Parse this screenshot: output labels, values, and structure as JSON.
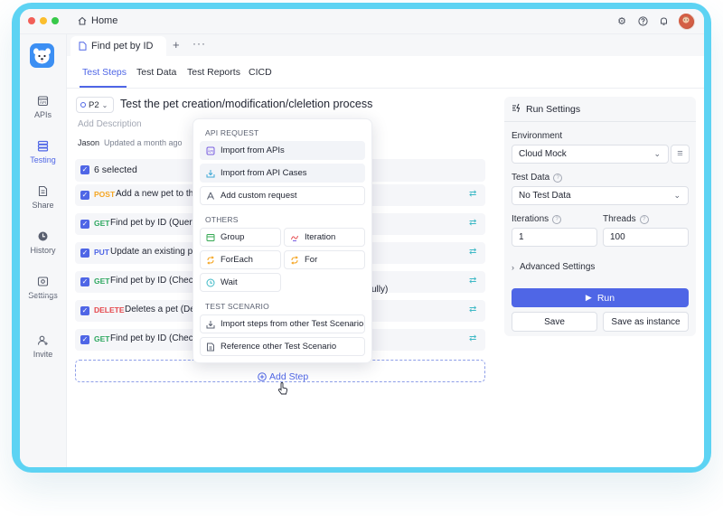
{
  "window": {
    "home_label": "Home",
    "colors": {
      "close": "#f25f58",
      "minimize": "#fbbe2e",
      "maximize": "#38c94a",
      "frame": "#5dd3f3",
      "accent": "#4f66e6"
    }
  },
  "sidebar": {
    "items": [
      {
        "label": "APIs",
        "icon": "apis-icon"
      },
      {
        "label": "Testing",
        "icon": "testing-icon"
      },
      {
        "label": "Share",
        "icon": "share-icon"
      },
      {
        "label": "History",
        "icon": "history-icon"
      },
      {
        "label": "Settings",
        "icon": "settings-icon"
      },
      {
        "label": "Invite",
        "icon": "invite-icon"
      }
    ]
  },
  "file_tab": {
    "label": "Find pet by ID"
  },
  "sub_tabs": [
    "Test Steps",
    "Test Data",
    "Test Reports",
    "CICD"
  ],
  "scenario": {
    "priority": "P2",
    "title": "Test the pet creation/modification/cleletion process",
    "add_description": "Add Description",
    "author": "Jason",
    "updated": "Updated a month ago"
  },
  "selection": {
    "label": "6 selected"
  },
  "steps": [
    {
      "method": "POST",
      "name": "Add a new pet to the",
      "color": "#f5a623"
    },
    {
      "method": "GET",
      "name": "Find pet by ID (Query",
      "color": "#2fa860"
    },
    {
      "method": "PUT",
      "name": "Update an existing pe",
      "color": "#4f66e6"
    },
    {
      "method": "GET",
      "name": "Find pet by ID (Check",
      "color": "#2fa860",
      "tail": "ully)"
    },
    {
      "method": "DELETE",
      "name": "Deletes a pet (Dele",
      "color": "#e5484d"
    },
    {
      "method": "GET",
      "name": "Find pet by ID (Check",
      "color": "#2fa860"
    }
  ],
  "add_step": {
    "label": "Add Step"
  },
  "dropdown": {
    "sections": {
      "api_request": "API REQUEST",
      "others": "OTHERS",
      "test_scenario": "TEST SCENARIO"
    },
    "api_request": [
      {
        "label": "Import from APIs",
        "icon": "import-apis-icon"
      },
      {
        "label": "Import from API Cases",
        "icon": "import-cases-icon"
      },
      {
        "label": "Add custom request",
        "icon": "custom-request-icon"
      }
    ],
    "others": [
      {
        "label": "Group",
        "icon": "group-icon"
      },
      {
        "label": "Iteration",
        "icon": "iteration-icon"
      },
      {
        "label": "ForEach",
        "icon": "foreach-icon"
      },
      {
        "label": "For",
        "icon": "for-icon"
      },
      {
        "label": "Wait",
        "icon": "wait-icon"
      }
    ],
    "test_scenario": [
      {
        "label": "Import steps from other Test Scenario",
        "icon": "import-steps-icon"
      },
      {
        "label": "Reference other Test Scenario",
        "icon": "reference-icon"
      }
    ]
  },
  "run_settings": {
    "title": "Run Settings",
    "environment_label": "Environment",
    "environment_value": "Cloud Mock",
    "test_data_label": "Test Data",
    "test_data_value": "No Test Data",
    "iterations_label": "Iterations",
    "iterations_value": "1",
    "threads_label": "Threads",
    "threads_value": "100",
    "advanced_label": "Advanced Settings",
    "run_label": "Run",
    "save_label": "Save",
    "save_instance_label": "Save as instance"
  }
}
